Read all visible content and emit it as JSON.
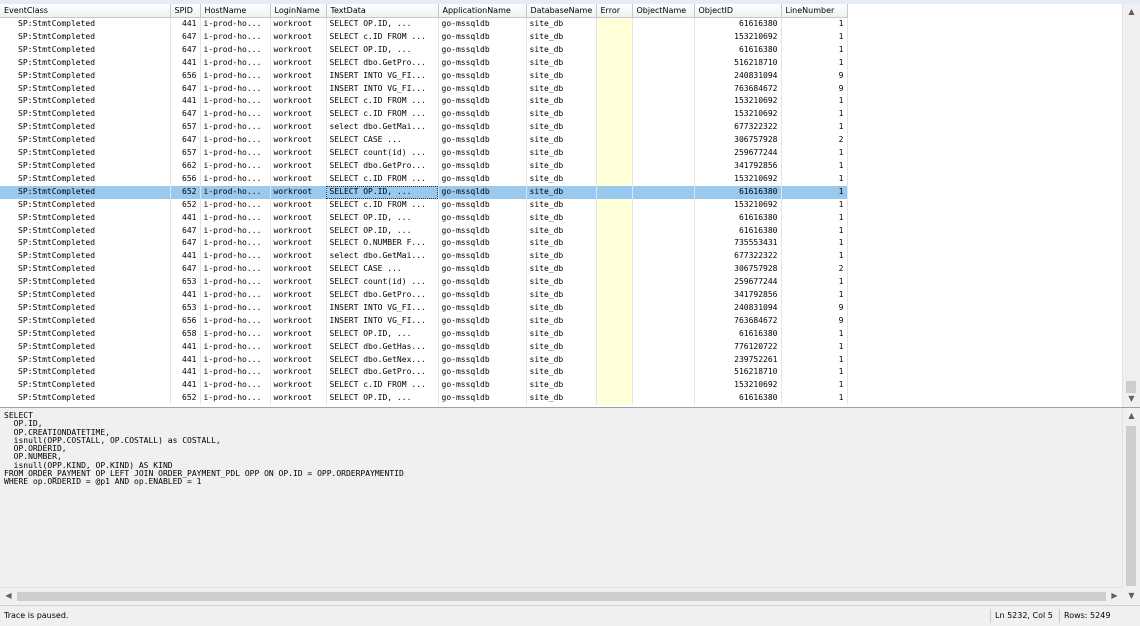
{
  "columns": [
    "EventClass",
    "SPID",
    "HostName",
    "LoginName",
    "TextData",
    "ApplicationName",
    "DatabaseName",
    "Error",
    "ObjectName",
    "ObjectID",
    "LineNumber"
  ],
  "rows": [
    [
      "SP:StmtCompleted",
      "441",
      "i-prod-ho...",
      "workroot",
      "SELECT    OP.ID,  ...",
      "go-mssqldb",
      "site_db",
      "",
      "",
      "61616380",
      "1"
    ],
    [
      "SP:StmtCompleted",
      "647",
      "i-prod-ho...",
      "workroot",
      "SELECT c.ID FROM ...",
      "go-mssqldb",
      "site_db",
      "",
      "",
      "153210692",
      "1"
    ],
    [
      "SP:StmtCompleted",
      "647",
      "i-prod-ho...",
      "workroot",
      "SELECT    OP.ID,  ...",
      "go-mssqldb",
      "site_db",
      "",
      "",
      "61616380",
      "1"
    ],
    [
      "SP:StmtCompleted",
      "441",
      "i-prod-ho...",
      "workroot",
      "SELECT dbo.GetPro...",
      "go-mssqldb",
      "site_db",
      "",
      "",
      "516218710",
      "1"
    ],
    [
      "SP:StmtCompleted",
      "656",
      "i-prod-ho...",
      "workroot",
      "INSERT INTO VG_FI...",
      "go-mssqldb",
      "site_db",
      "",
      "",
      "240831094",
      "9"
    ],
    [
      "SP:StmtCompleted",
      "647",
      "i-prod-ho...",
      "workroot",
      "INSERT INTO VG_FI...",
      "go-mssqldb",
      "site_db",
      "",
      "",
      "763684672",
      "9"
    ],
    [
      "SP:StmtCompleted",
      "441",
      "i-prod-ho...",
      "workroot",
      "SELECT c.ID FROM ...",
      "go-mssqldb",
      "site_db",
      "",
      "",
      "153210692",
      "1"
    ],
    [
      "SP:StmtCompleted",
      "647",
      "i-prod-ho...",
      "workroot",
      "SELECT c.ID FROM ...",
      "go-mssqldb",
      "site_db",
      "",
      "",
      "153210692",
      "1"
    ],
    [
      "SP:StmtCompleted",
      "657",
      "i-prod-ho...",
      "workroot",
      "select dbo.GetMai...",
      "go-mssqldb",
      "site_db",
      "",
      "",
      "677322322",
      "1"
    ],
    [
      "SP:StmtCompleted",
      "647",
      "i-prod-ho...",
      "workroot",
      "SELECT CASE      ...",
      "go-mssqldb",
      "site_db",
      "",
      "",
      "306757928",
      "2"
    ],
    [
      "SP:StmtCompleted",
      "657",
      "i-prod-ho...",
      "workroot",
      "SELECT count(id) ...",
      "go-mssqldb",
      "site_db",
      "",
      "",
      "259677244",
      "1"
    ],
    [
      "SP:StmtCompleted",
      "662",
      "i-prod-ho...",
      "workroot",
      "SELECT dbo.GetPro...",
      "go-mssqldb",
      "site_db",
      "",
      "",
      "341792856",
      "1"
    ],
    [
      "SP:StmtCompleted",
      "656",
      "i-prod-ho...",
      "workroot",
      "SELECT c.ID FROM ...",
      "go-mssqldb",
      "site_db",
      "",
      "",
      "153210692",
      "1"
    ],
    [
      "SP:StmtCompleted",
      "652",
      "i-prod-ho...",
      "workroot",
      "SELECT    OP.ID,  ...",
      "go-mssqldb",
      "site_db",
      "",
      "",
      "61616380",
      "1"
    ],
    [
      "SP:StmtCompleted",
      "652",
      "i-prod-ho...",
      "workroot",
      "SELECT c.ID FROM ...",
      "go-mssqldb",
      "site_db",
      "",
      "",
      "153210692",
      "1"
    ],
    [
      "SP:StmtCompleted",
      "441",
      "i-prod-ho...",
      "workroot",
      "SELECT    OP.ID,  ...",
      "go-mssqldb",
      "site_db",
      "",
      "",
      "61616380",
      "1"
    ],
    [
      "SP:StmtCompleted",
      "647",
      "i-prod-ho...",
      "workroot",
      "SELECT    OP.ID,  ...",
      "go-mssqldb",
      "site_db",
      "",
      "",
      "61616380",
      "1"
    ],
    [
      "SP:StmtCompleted",
      "647",
      "i-prod-ho...",
      "workroot",
      "SELECT O.NUMBER F...",
      "go-mssqldb",
      "site_db",
      "",
      "",
      "735553431",
      "1"
    ],
    [
      "SP:StmtCompleted",
      "441",
      "i-prod-ho...",
      "workroot",
      "select dbo.GetMai...",
      "go-mssqldb",
      "site_db",
      "",
      "",
      "677322322",
      "1"
    ],
    [
      "SP:StmtCompleted",
      "647",
      "i-prod-ho...",
      "workroot",
      "SELECT CASE      ...",
      "go-mssqldb",
      "site_db",
      "",
      "",
      "306757928",
      "2"
    ],
    [
      "SP:StmtCompleted",
      "653",
      "i-prod-ho...",
      "workroot",
      "SELECT count(id) ...",
      "go-mssqldb",
      "site_db",
      "",
      "",
      "259677244",
      "1"
    ],
    [
      "SP:StmtCompleted",
      "441",
      "i-prod-ho...",
      "workroot",
      "SELECT dbo.GetPro...",
      "go-mssqldb",
      "site_db",
      "",
      "",
      "341792856",
      "1"
    ],
    [
      "SP:StmtCompleted",
      "653",
      "i-prod-ho...",
      "workroot",
      "INSERT INTO VG_FI...",
      "go-mssqldb",
      "site_db",
      "",
      "",
      "240831094",
      "9"
    ],
    [
      "SP:StmtCompleted",
      "656",
      "i-prod-ho...",
      "workroot",
      "INSERT INTO VG_FI...",
      "go-mssqldb",
      "site_db",
      "",
      "",
      "763684672",
      "9"
    ],
    [
      "SP:StmtCompleted",
      "658",
      "i-prod-ho...",
      "workroot",
      "SELECT    OP.ID,  ...",
      "go-mssqldb",
      "site_db",
      "",
      "",
      "61616380",
      "1"
    ],
    [
      "SP:StmtCompleted",
      "441",
      "i-prod-ho...",
      "workroot",
      "SELECT dbo.GetHas...",
      "go-mssqldb",
      "site_db",
      "",
      "",
      "776120722",
      "1"
    ],
    [
      "SP:StmtCompleted",
      "441",
      "i-prod-ho...",
      "workroot",
      "SELECT dbo.GetNex...",
      "go-mssqldb",
      "site_db",
      "",
      "",
      "239752261",
      "1"
    ],
    [
      "SP:StmtCompleted",
      "441",
      "i-prod-ho...",
      "workroot",
      "SELECT dbo.GetPro...",
      "go-mssqldb",
      "site_db",
      "",
      "",
      "516218710",
      "1"
    ],
    [
      "SP:StmtCompleted",
      "441",
      "i-prod-ho...",
      "workroot",
      "SELECT c.ID FROM ...",
      "go-mssqldb",
      "site_db",
      "",
      "",
      "153210692",
      "1"
    ],
    [
      "SP:StmtCompleted",
      "652",
      "i-prod-ho...",
      "workroot",
      "SELECT    OP.ID,  ...",
      "go-mssqldb",
      "site_db",
      "",
      "",
      "61616380",
      "1"
    ]
  ],
  "selected_row": 13,
  "detail_text": "SELECT\n  OP.ID,\n  OP.CREATIONDATETIME,\n  isnull(OPP.COSTALL, OP.COSTALL) as COSTALL,\n  OP.ORDERID,\n  OP.NUMBER,\n  isnull(OPP.KIND, OP.KIND) AS KIND\nFROM ORDER_PAYMENT OP LEFT JOIN ORDER_PAYMENT_PDL OPP ON OP.ID = OPP.ORDERPAYMENTID\nWHERE op.ORDERID = @p1 AND op.ENABLED = 1",
  "status": {
    "message": "Trace is paused.",
    "position": "Ln 5232, Col 5",
    "rows": "Rows: 5249"
  },
  "colors": {
    "selection": "#99c9ef",
    "error_column": "#ffffd8"
  },
  "icons": {
    "scroll_up": "up-arrow",
    "scroll_down": "down-arrow",
    "scroll_left": "left-arrow",
    "scroll_right": "right-arrow"
  }
}
